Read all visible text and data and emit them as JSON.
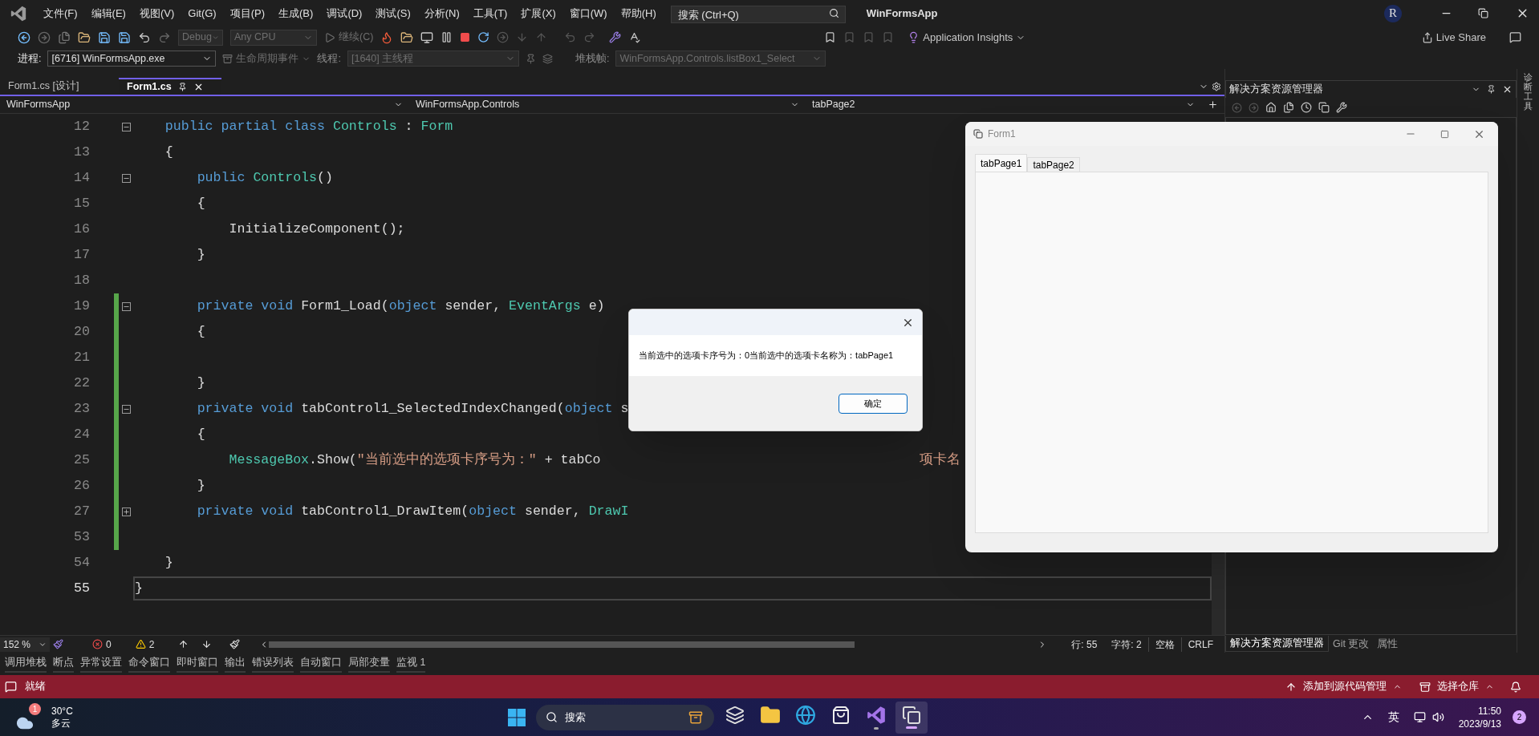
{
  "menu_bar": {
    "items": [
      "文件(F)",
      "编辑(E)",
      "视图(V)",
      "Git(G)",
      "项目(P)",
      "生成(B)",
      "调试(D)",
      "测试(S)",
      "分析(N)",
      "工具(T)",
      "扩展(X)",
      "窗口(W)",
      "帮助(H)"
    ],
    "search": {
      "placeholder": "搜索 (Ctrl+Q)"
    },
    "solution_name": "WinFormsApp",
    "account_initial": "R"
  },
  "toolbar": {
    "configuration": {
      "value": "Debug",
      "disabled": true
    },
    "platform": {
      "value": "Any CPU",
      "disabled": true
    },
    "continue_button": {
      "label": "继续(C)",
      "disabled": true
    },
    "insights_button": "Application Insights",
    "live_share": "Live Share"
  },
  "debug_location": {
    "process_label": "进程:",
    "process": {
      "value": "[6716] WinFormsApp.exe",
      "disabled": false
    },
    "lifecycle": {
      "label": "生命周期事件",
      "disabled": true
    },
    "thread_label": "线程:",
    "thread": {
      "value": "[1640] 主线程",
      "disabled": true
    },
    "stack_label": "堆栈帧:",
    "stack_frame": {
      "value": "WinFormsApp.Controls.listBox1_Select",
      "disabled": true
    }
  },
  "document_tabs": [
    {
      "label": "Form1.cs [设计]",
      "selected": false
    },
    {
      "label": "Form1.cs",
      "selected": true
    }
  ],
  "navigation_bar": {
    "project": "WinFormsApp",
    "type": "WinFormsApp.Controls",
    "member": "tabPage2"
  },
  "code_lines": [
    {
      "number": "12",
      "kind": "expanded-block",
      "changed": false,
      "current": false,
      "tokens": [
        {
          "kind": "keyword",
          "text": "    public partial class "
        },
        {
          "kind": "type",
          "text": "Controls"
        },
        {
          "kind": "plain",
          "text": " : "
        },
        {
          "kind": "type",
          "text": "Form"
        }
      ]
    },
    {
      "number": "13",
      "changed": false,
      "current": false,
      "tokens": [
        {
          "kind": "plain",
          "text": "    {"
        }
      ]
    },
    {
      "number": "14",
      "kind": "expanded-block",
      "changed": false,
      "current": false,
      "tokens": [
        {
          "kind": "keyword",
          "text": "        public "
        },
        {
          "kind": "type",
          "text": "Controls"
        },
        {
          "kind": "plain",
          "text": "()"
        }
      ]
    },
    {
      "number": "15",
      "changed": false,
      "current": false,
      "tokens": [
        {
          "kind": "plain",
          "text": "        {"
        }
      ]
    },
    {
      "number": "16",
      "changed": false,
      "current": false,
      "tokens": [
        {
          "kind": "plain",
          "text": "            InitializeComponent();"
        }
      ]
    },
    {
      "number": "17",
      "changed": false,
      "current": false,
      "tokens": [
        {
          "kind": "plain",
          "text": "        }"
        }
      ]
    },
    {
      "number": "18",
      "changed": false,
      "current": false
    },
    {
      "number": "19",
      "kind": "expanded-block",
      "changed": true,
      "current": false,
      "tokens": [
        {
          "kind": "keyword",
          "text": "        private void "
        },
        {
          "kind": "plain",
          "text": "Form1_Load("
        },
        {
          "kind": "keyword",
          "text": "object"
        },
        {
          "kind": "plain",
          "text": " sender, "
        },
        {
          "kind": "type",
          "text": "EventArgs"
        },
        {
          "kind": "plain",
          "text": " e)"
        }
      ]
    },
    {
      "number": "20",
      "changed": true,
      "current": false,
      "tokens": [
        {
          "kind": "plain",
          "text": "        {"
        }
      ]
    },
    {
      "number": "21",
      "changed": true,
      "current": false
    },
    {
      "number": "22",
      "changed": true,
      "current": false,
      "tokens": [
        {
          "kind": "plain",
          "text": "        }"
        }
      ]
    },
    {
      "number": "23",
      "kind": "expanded-block",
      "changed": true,
      "current": false,
      "tokens": [
        {
          "kind": "keyword",
          "text": "        private void "
        },
        {
          "kind": "plain",
          "text": "tabControl1_SelectedIndexChanged("
        },
        {
          "kind": "keyword",
          "text": "object"
        },
        {
          "kind": "plain",
          "text": " s"
        }
      ]
    },
    {
      "number": "24",
      "changed": true,
      "current": false,
      "tokens": [
        {
          "kind": "plain",
          "text": "        {"
        }
      ]
    },
    {
      "number": "25",
      "changed": true,
      "current": false,
      "tokens": [
        {
          "kind": "type",
          "text": "            MessageBox"
        },
        {
          "kind": "plain",
          "text": ".Show("
        },
        {
          "kind": "string",
          "text": "\"当前选中的选项卡序号为：\""
        },
        {
          "kind": "plain",
          "text": " + tabCo"
        }
      ],
      "tokens_after_dialog": [
        {
          "kind": "string",
          "text": "项卡名"
        }
      ]
    },
    {
      "number": "26",
      "changed": true,
      "current": false,
      "tokens": [
        {
          "kind": "plain",
          "text": "        }"
        }
      ]
    },
    {
      "number": "27",
      "kind": "collapsed-block",
      "changed": true,
      "current": false,
      "tokens": [
        {
          "kind": "keyword",
          "text": "        private void "
        },
        {
          "kind": "plain",
          "text": "tabControl1_DrawItem("
        },
        {
          "kind": "keyword",
          "text": "object"
        },
        {
          "kind": "plain",
          "text": " sender, "
        },
        {
          "kind": "type",
          "text": "DrawI"
        }
      ]
    },
    {
      "number": "53",
      "changed": true,
      "current": false
    },
    {
      "number": "54",
      "changed": false,
      "current": false,
      "tokens": [
        {
          "kind": "plain",
          "text": "    }"
        }
      ]
    },
    {
      "number": "55",
      "changed": false,
      "current": true,
      "tokens": [
        {
          "kind": "plain",
          "text": "}"
        }
      ]
    }
  ],
  "editor_status": {
    "zoom": "152 %",
    "errors": "0",
    "warnings": "2",
    "line": "行: 55",
    "column": "字符: 2",
    "whitespace": "空格",
    "line_ending": "CRLF"
  },
  "tool_tabs": [
    "调用堆栈",
    "断点",
    "异常设置",
    "命令窗口",
    "即时窗口",
    "输出",
    "错误列表",
    "自动窗口",
    "局部变量",
    "监视 1"
  ],
  "solution_explorer": {
    "title": "解决方案资源管理器",
    "tabs": [
      {
        "label": "解决方案资源管理器",
        "selected": true
      },
      {
        "label": "Git 更改",
        "selected": false
      },
      {
        "label": "属性",
        "selected": false
      }
    ]
  },
  "side_strip": "诊断工具",
  "status_bar": {
    "message": "就绪",
    "source_control": "添加到源代码管理",
    "repository": "选择仓库"
  },
  "form_window": {
    "title": "Form1",
    "tabs": [
      {
        "label": "tabPage1",
        "selected": true
      },
      {
        "label": "tabPage2",
        "selected": false
      }
    ]
  },
  "message_box": {
    "text": "当前选中的选项卡序号为：0当前选中的选项卡名称为：tabPage1",
    "button": "确定"
  },
  "taskbar": {
    "weather": {
      "badge": "1",
      "temperature": "30°C",
      "condition": "多云"
    },
    "search_placeholder": "搜索",
    "apps": [
      {
        "kind": "task-view",
        "running": false,
        "selected": false
      },
      {
        "kind": "file-explorer",
        "running": false,
        "selected": false
      },
      {
        "kind": "browser",
        "running": false,
        "selected": false
      },
      {
        "kind": "store",
        "running": false,
        "selected": false
      },
      {
        "kind": "visual-studio",
        "running": true,
        "selected": false
      },
      {
        "kind": "form-app",
        "running": true,
        "selected": true
      }
    ],
    "input_method": "英",
    "time": "11:50",
    "date": "2023/9/13",
    "notifications": "2"
  }
}
